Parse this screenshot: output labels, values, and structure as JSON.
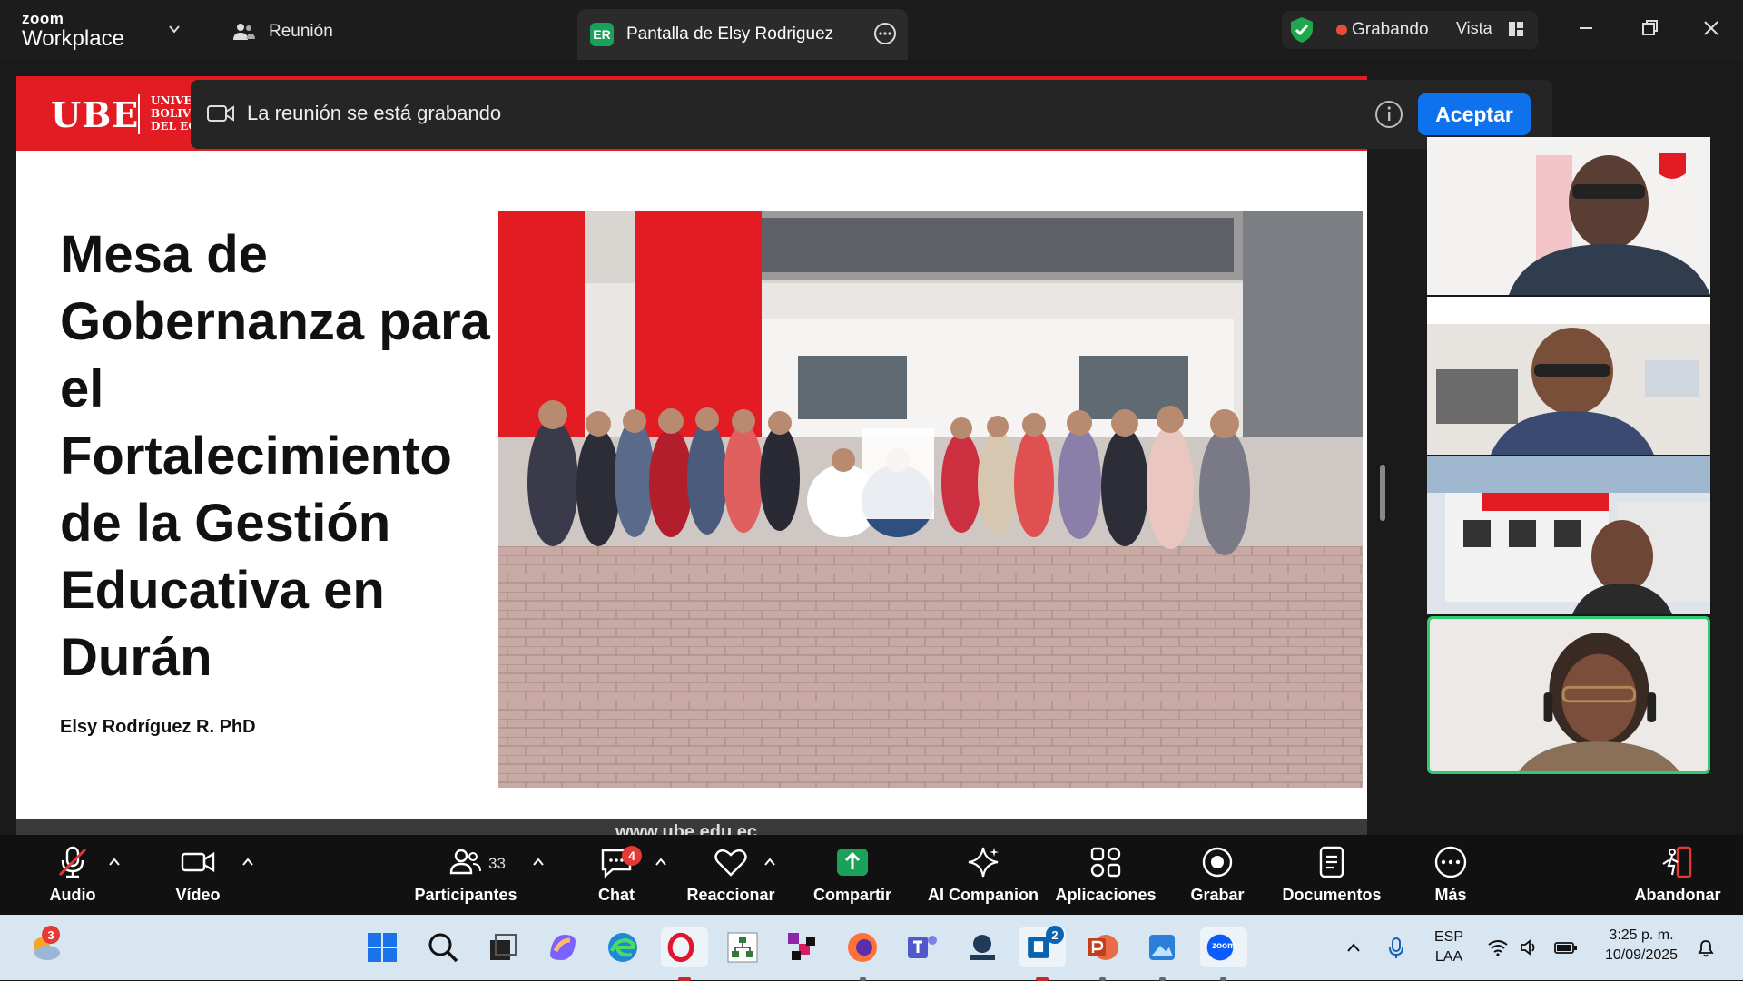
{
  "titlebar": {
    "brand_top": "zoom",
    "brand_bottom": "Workplace",
    "meeting_tab": "Reunión",
    "share_badge": "ER",
    "share_tab": "Pantalla de Elsy Rodriguez",
    "recording": "Grabando",
    "view": "Vista"
  },
  "notice": {
    "text": "La reunión se está grabando",
    "accept": "Aceptar"
  },
  "slide": {
    "logo": "UBE",
    "logo_sub": [
      "UNIVE",
      "BOLIV",
      "DEL EC"
    ],
    "title": "Mesa de Gobernanza para el Fortalecimiento de la Gestión Educativa en Durán",
    "author": "Elsy Rodríguez R. PhD",
    "url": "www.ube.edu.ec"
  },
  "toolbar": {
    "audio": "Audio",
    "video": "Vídeo",
    "participants": "Participantes",
    "participants_count": "33",
    "chat": "Chat",
    "chat_badge": "4",
    "react": "Reaccionar",
    "share": "Compartir",
    "ai": "AI Companion",
    "apps": "Aplicaciones",
    "record": "Grabar",
    "docs": "Documentos",
    "more": "Más",
    "leave": "Abandonar"
  },
  "taskbar": {
    "weather_badge": "3",
    "teams_badge": "2",
    "zoom_label": "zoom",
    "lang_top": "ESP",
    "lang_bottom": "LAA",
    "time": "3:25 p. m.",
    "date": "10/09/2025"
  },
  "colors": {
    "brand_red": "#e31b23",
    "accent_blue": "#0e72ed",
    "record_red": "#e74c3c",
    "active_green": "#2ecc71",
    "share_green": "#1aa25b"
  }
}
